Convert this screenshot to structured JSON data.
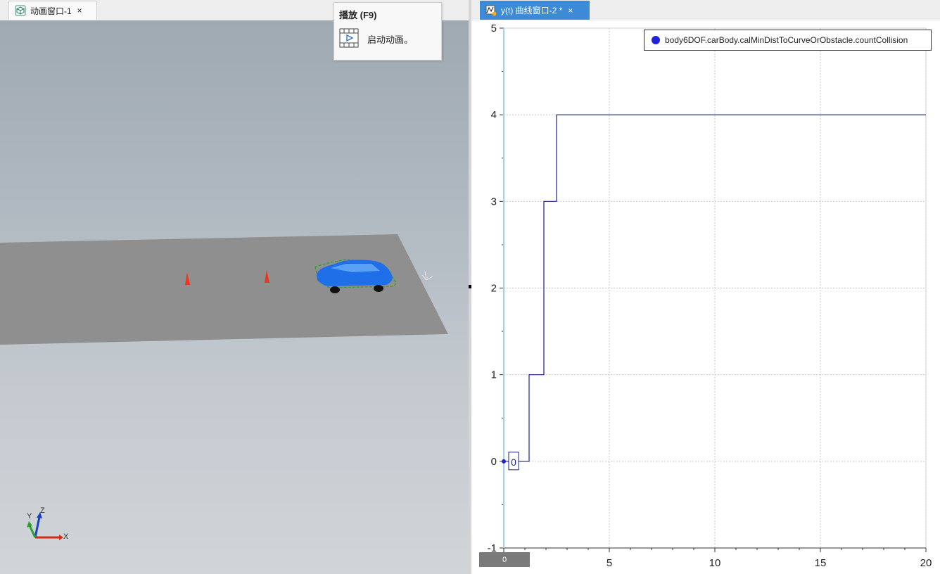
{
  "left_tab": {
    "label": "动画窗口-1",
    "close": "×"
  },
  "right_tab": {
    "label": "y(t) 曲线窗口-2 *",
    "close": "×"
  },
  "tooltip": {
    "title": "播放 (F9)",
    "description": "启动动画。"
  },
  "axes_triad": {
    "x": "X",
    "y": "Y",
    "z": "Z"
  },
  "colors": {
    "accent": "#3d8ad6",
    "series": "#1a1f8c",
    "legend_dot": "#1e22d8",
    "car": "#1e6fe8",
    "cone": "#e83a1c",
    "ground": "#8f8f8f"
  },
  "scrollbar": {
    "value": "0"
  },
  "chart_data": {
    "type": "line",
    "series": [
      {
        "name": "body6DOF.carBody.calMinDistToCurveOrObstacle.countCollision",
        "points": [
          [
            0,
            0
          ],
          [
            1.2,
            0
          ],
          [
            1.2,
            1
          ],
          [
            1.9,
            1
          ],
          [
            1.9,
            3
          ],
          [
            2.5,
            3
          ],
          [
            2.5,
            4
          ],
          [
            20,
            4
          ]
        ]
      }
    ],
    "xlim": [
      0,
      20
    ],
    "ylim": [
      -1,
      5
    ],
    "xticks": [
      "0",
      "5",
      "10",
      "15",
      "20"
    ],
    "yticks": [
      "-1",
      "0",
      "1",
      "2",
      "3",
      "4",
      "5"
    ],
    "marker_label": "0",
    "grid": true,
    "legend": "top-right"
  }
}
